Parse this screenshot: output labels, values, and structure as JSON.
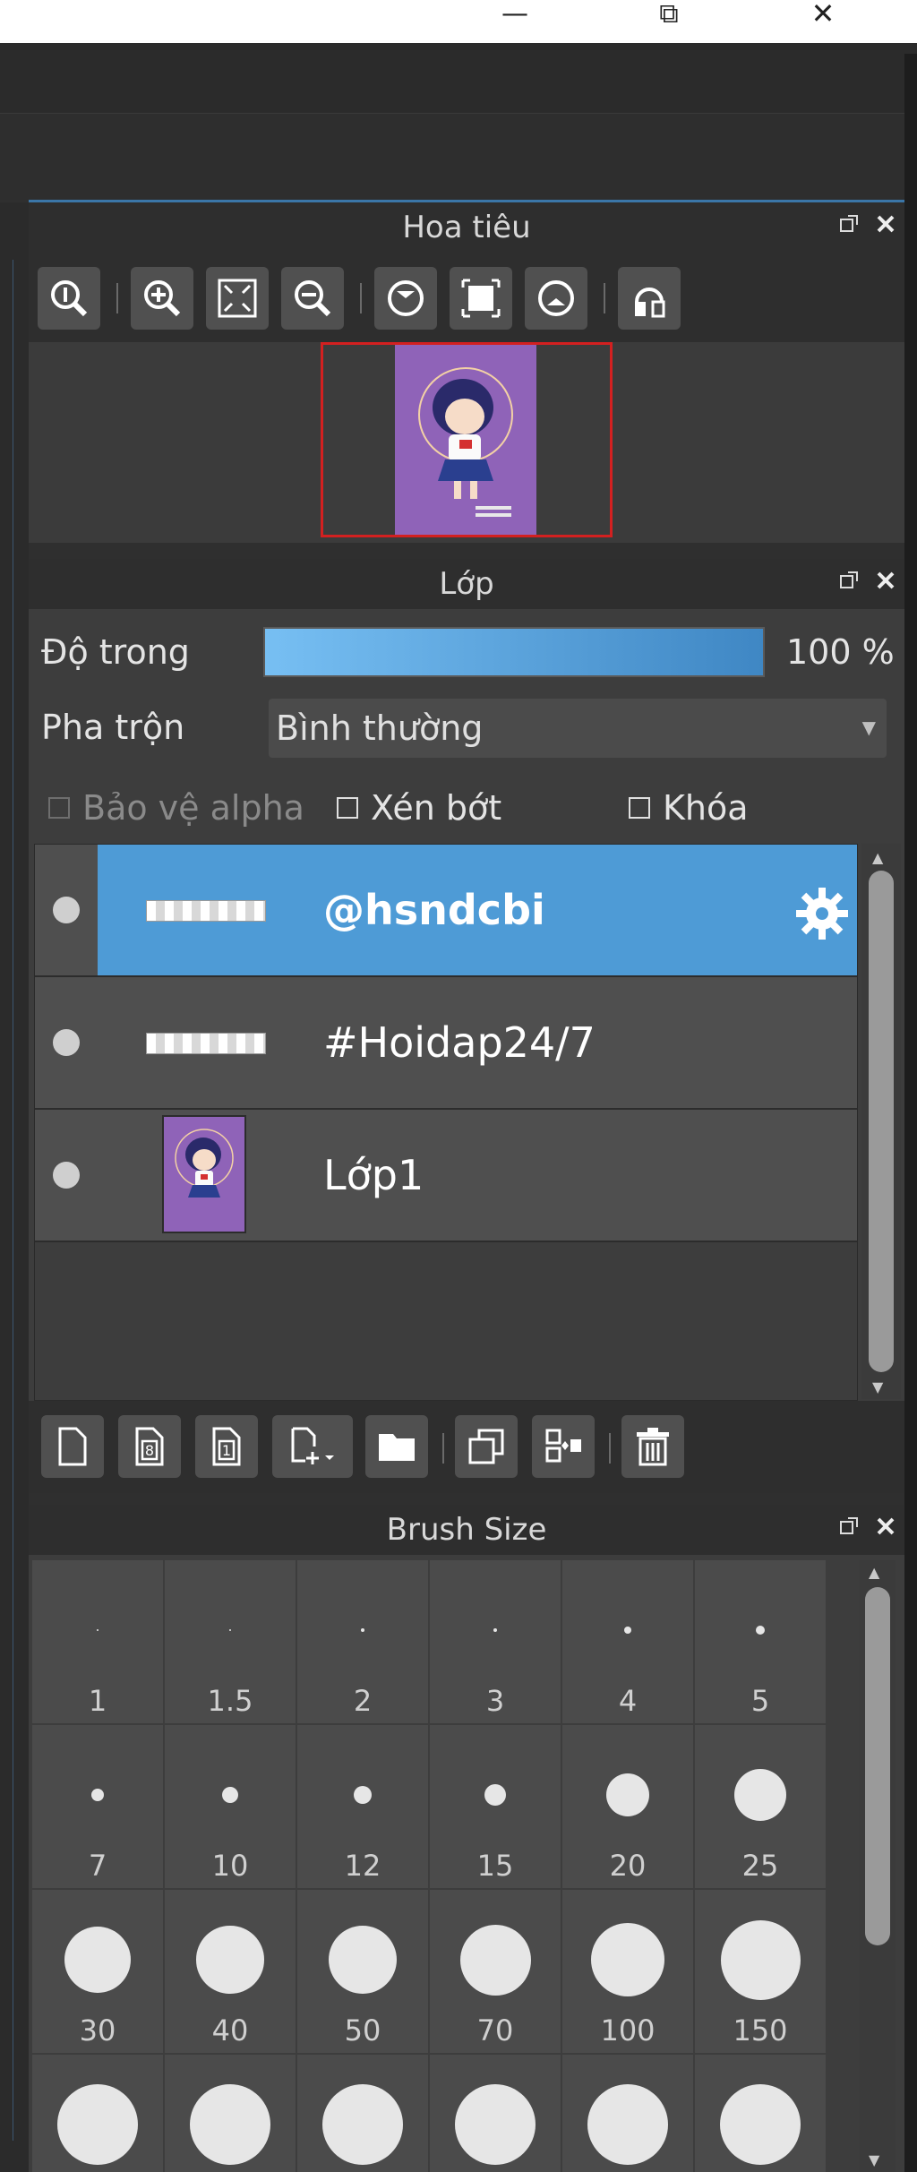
{
  "window": {
    "minimize_glyph": "—",
    "maximize_glyph": "⧉",
    "close_glyph": "✕"
  },
  "navigator": {
    "title": "Hoa tiêu",
    "tools": [
      "zoom-actual-icon",
      "zoom-in-icon",
      "fit-icon",
      "zoom-out-icon",
      "rotate-left-icon",
      "fit-canvas-icon",
      "rotate-right-icon",
      "flip-icon"
    ]
  },
  "layers": {
    "title": "Lớp",
    "opacity_label": "Độ trong",
    "opacity_value": "100 %",
    "opacity_fraction": 1.0,
    "blend_label": "Pha trộn",
    "blend_value": "Bình thường",
    "protect_alpha": "Bảo vệ alpha",
    "clipping": "Xén bớt",
    "lock": "Khóa",
    "items": [
      {
        "name": "@hsndcbi",
        "selected": true
      },
      {
        "name": "#Hoidap24/7",
        "selected": false
      },
      {
        "name": "Lớp1",
        "selected": false
      }
    ]
  },
  "brush": {
    "title": "Brush Size",
    "sizes": [
      "1",
      "1.5",
      "2",
      "3",
      "4",
      "5",
      "7",
      "10",
      "12",
      "15",
      "20",
      "25",
      "30",
      "40",
      "50",
      "70",
      "100",
      "150"
    ]
  },
  "colors": {
    "selected_row": "#4e9bd6",
    "opacity_start": "#77bff3",
    "opacity_end": "#3f87c4",
    "nav_frame": "#d32020",
    "canvas_purple": "#8f63b8"
  }
}
